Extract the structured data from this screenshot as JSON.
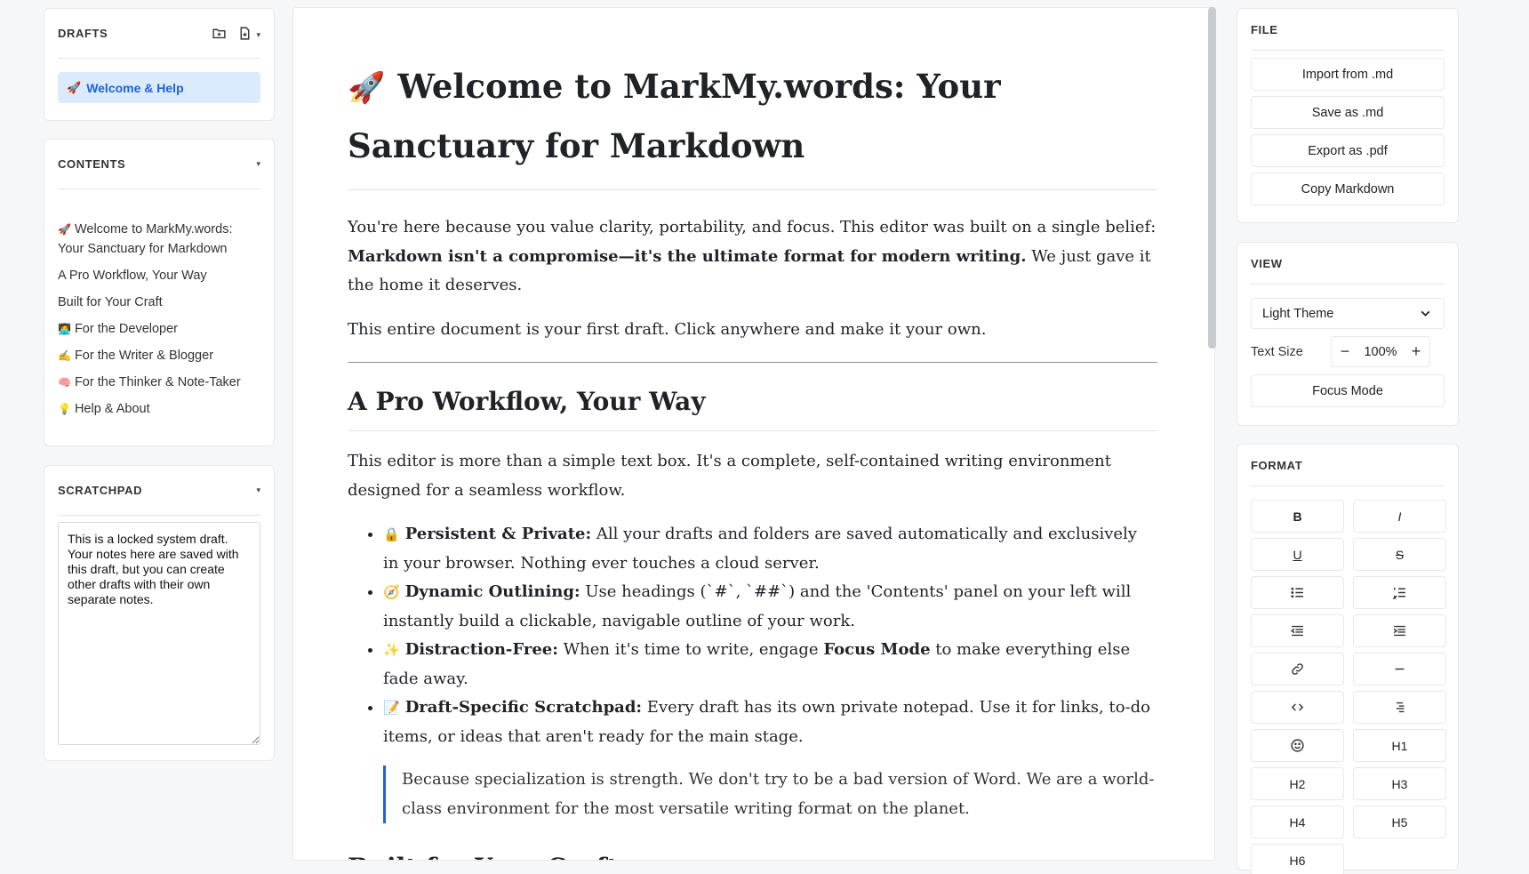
{
  "drafts": {
    "title": "DRAFTS",
    "items": [
      {
        "emoji": "🚀",
        "label": "Welcome & Help"
      }
    ]
  },
  "contents": {
    "title": "CONTENTS",
    "items": [
      {
        "emoji": "🚀",
        "label": "Welcome to MarkMy.words: Your Sanctuary for Markdown"
      },
      {
        "emoji": "",
        "label": "A Pro Workflow, Your Way"
      },
      {
        "emoji": "",
        "label": "Built for Your Craft"
      },
      {
        "emoji": "🧑‍💻",
        "label": "For the Developer"
      },
      {
        "emoji": "✍️",
        "label": "For the Writer & Blogger"
      },
      {
        "emoji": "🧠",
        "label": "For the Thinker & Note-Taker"
      },
      {
        "emoji": "💡",
        "label": "Help & About"
      }
    ]
  },
  "scratchpad": {
    "title": "SCRATCHPAD",
    "text": "This is a locked system draft. Your notes here are saved with this draft, but you can create other drafts with their own separate notes."
  },
  "document": {
    "h1_emoji": "🚀",
    "h1": "Welcome to MarkMy.words: Your Sanctuary for Markdown",
    "p1_a": "You're here because you value clarity, portability, and focus. This editor was built on a single belief: ",
    "p1_bold": "Markdown isn't a compromise—it's the ultimate format for modern writing.",
    "p1_b": " We just gave it the home it deserves.",
    "p2": "This entire document is your first draft. Click anywhere and make it your own.",
    "h2_1": "A Pro Workflow, Your Way",
    "p3": "This editor is more than a simple text box. It's a complete, self-contained writing environment designed for a seamless workflow.",
    "bullets": [
      {
        "emoji": "🔒",
        "title": "Persistent & Private:",
        "text": " All your drafts and folders are saved automatically and exclusively in your browser. Nothing ever touches a cloud server."
      },
      {
        "emoji": "🧭",
        "title": "Dynamic Outlining:",
        "text": " Use headings (`#`, `##`) and the 'Contents' panel on your left will instantly build a clickable, navigable outline of your work."
      },
      {
        "emoji": "✨",
        "title": "Distraction-Free:",
        "text": " When it's time to write, engage ",
        "bold2": "Focus Mode",
        "text2": " to make everything else fade away."
      },
      {
        "emoji": "📝",
        "title": "Draft-Specific Scratchpad:",
        "text": " Every draft has its own private notepad. Use it for links, to-do items, or ideas that aren't ready for the main stage."
      }
    ],
    "quote": "Because specialization is strength. We don't try to be a bad version of Word. We are a world-class environment for the most versatile writing format on the planet.",
    "h2_2": "Built for Your Craft"
  },
  "file": {
    "title": "FILE",
    "import_label": "Import from .md",
    "save_label": "Save as .md",
    "export_label": "Export as .pdf",
    "copy_label": "Copy Markdown"
  },
  "view": {
    "title": "VIEW",
    "theme": "Light Theme",
    "text_size_label": "Text Size",
    "text_size_value": "100%",
    "minus": "−",
    "plus": "+",
    "focus_label": "Focus Mode"
  },
  "format": {
    "title": "FORMAT",
    "bold": "B",
    "italic": "I",
    "underline": "U",
    "strike": "S",
    "h1": "H1",
    "h2": "H2",
    "h3": "H3",
    "h4": "H4",
    "h5": "H5",
    "h6": "H6"
  }
}
